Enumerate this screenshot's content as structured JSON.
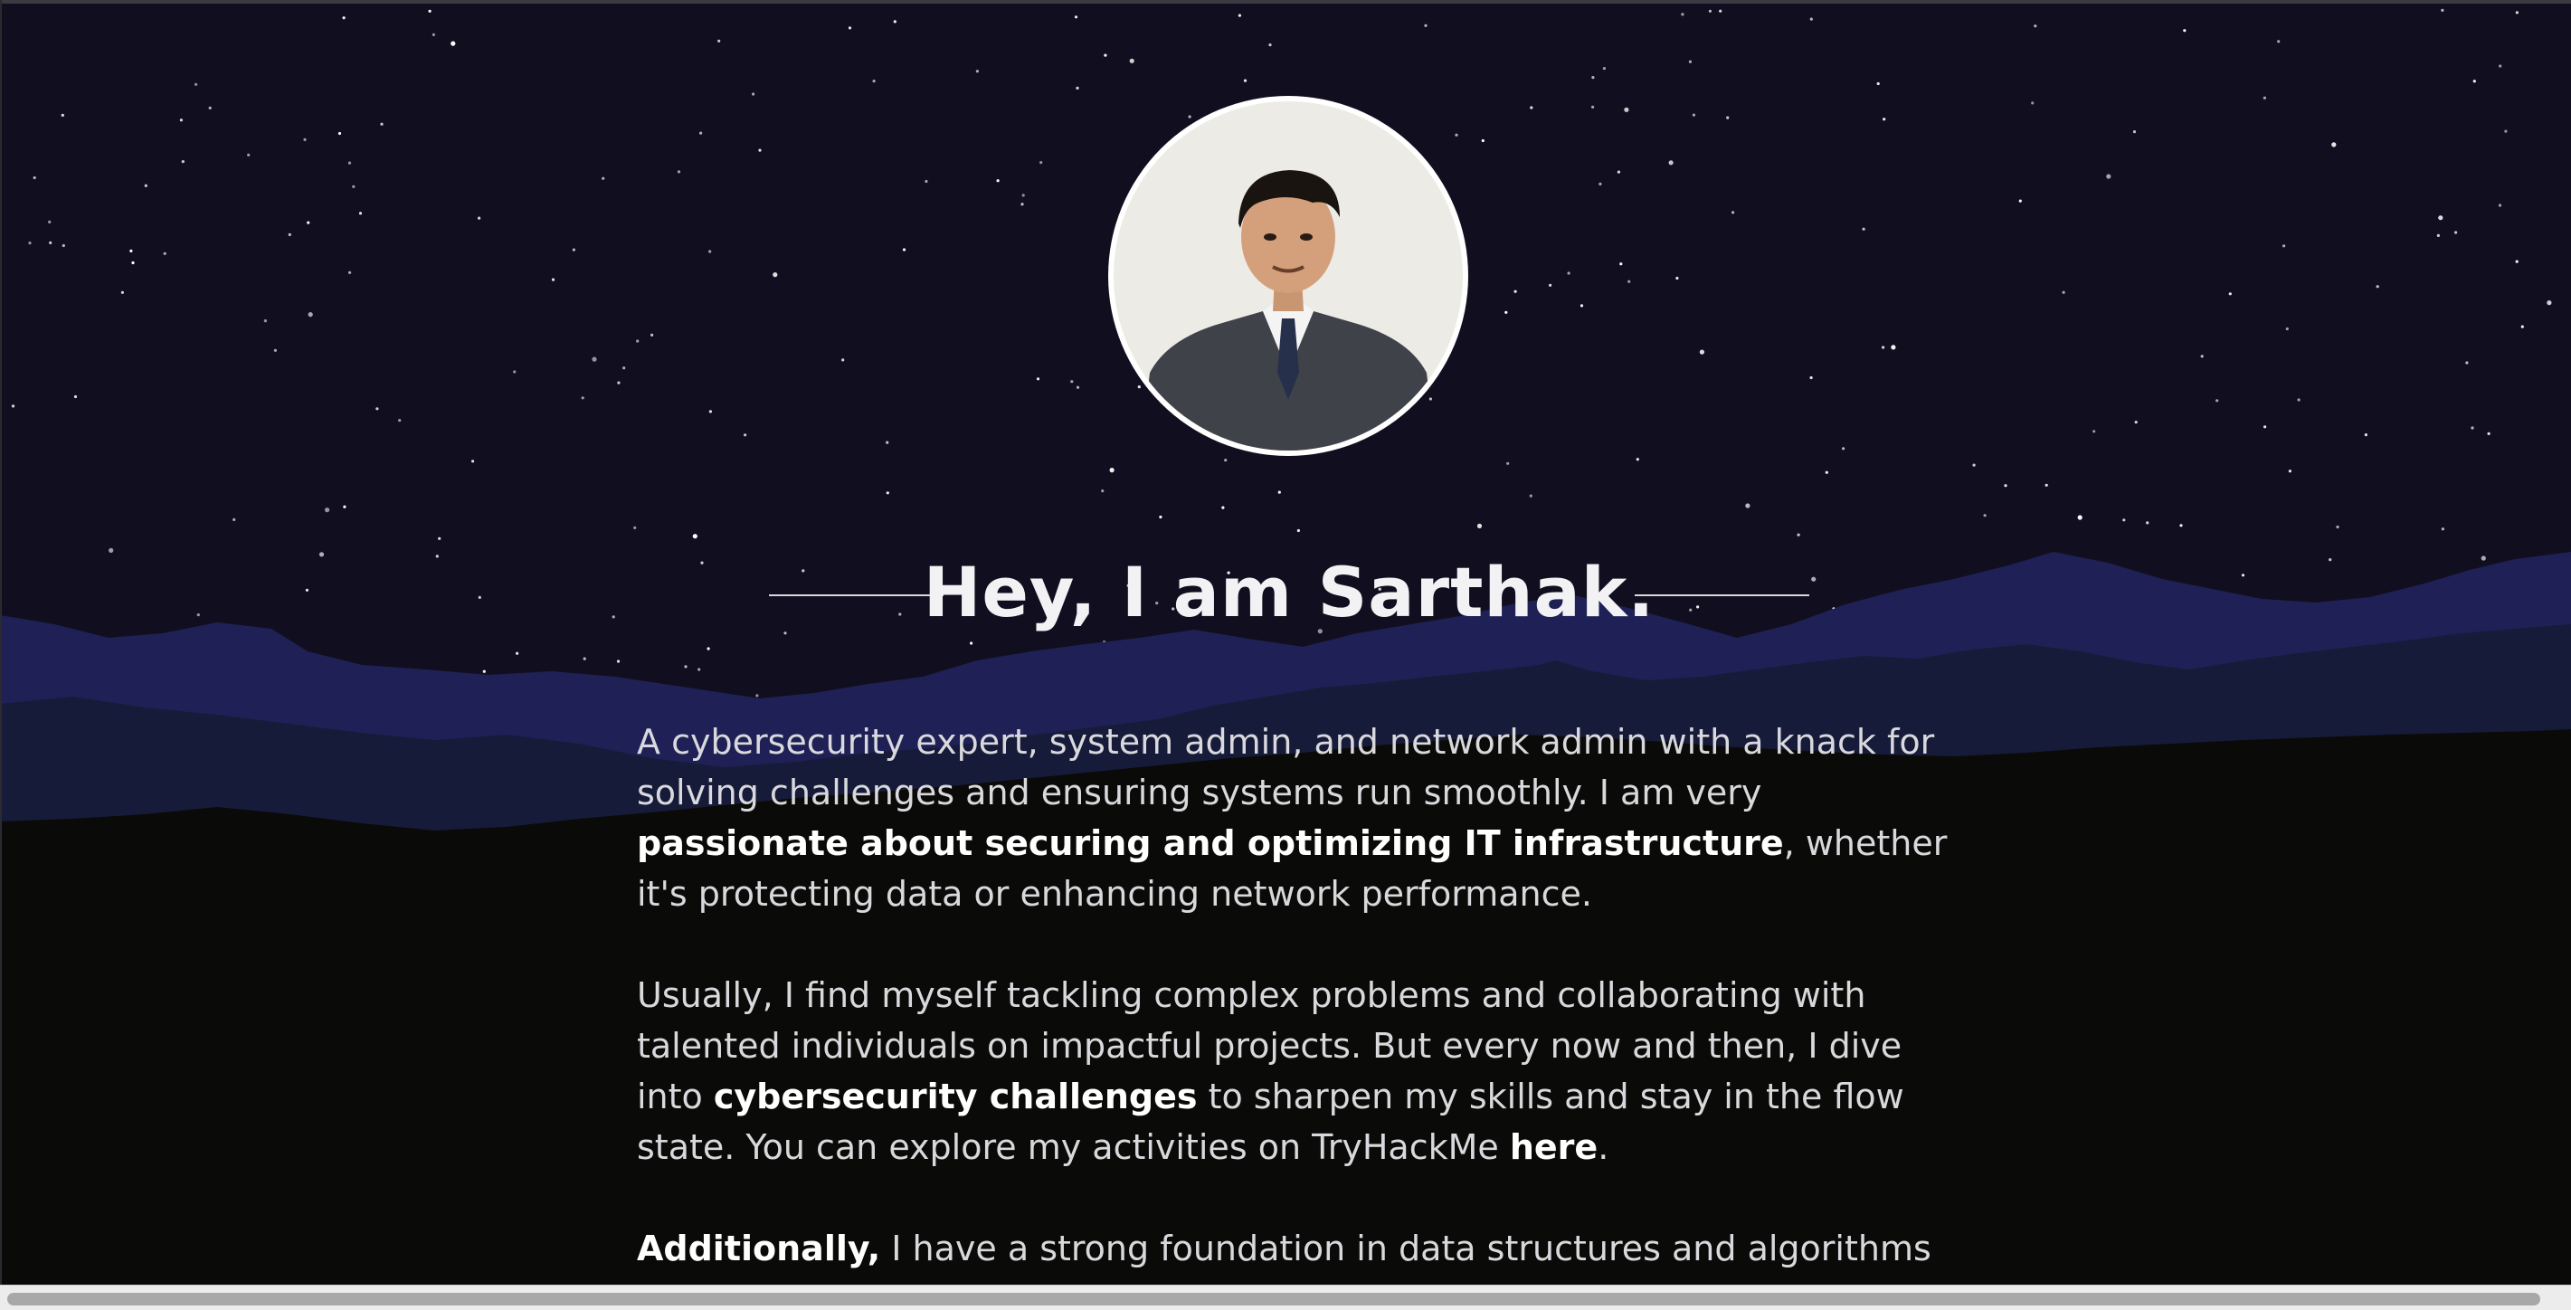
{
  "profile": {
    "avatar_alt": "Portrait of Sarthak"
  },
  "hero": {
    "title": "Hey, I am Sarthak."
  },
  "about": {
    "p1": {
      "t1": "A cybersecurity expert, system admin, and network admin with a knack for solving challenges and ensuring systems run smoothly. I am very ",
      "b1": "passionate about securing and optimizing IT infrastructure",
      "t2": ", whether it's protecting data or enhancing network performance."
    },
    "p2": {
      "t1": "Usually, I find myself tackling complex problems and collaborating with talented individuals on impactful projects. But every now and then, I dive into ",
      "b1": "cybersecurity challenges",
      "t2": " to sharpen my skills and stay in the flow state. You can explore my activities on TryHackMe ",
      "link": "here",
      "t3": "."
    },
    "p3": {
      "b1": "Additionally,",
      "t1": " I have a strong foundation in data structures and algorithms"
    }
  },
  "colors": {
    "sky": "#110f1f",
    "mountain_far": "#1f2156",
    "mountain_mid": "#171b3a",
    "ground": "#0a0b08",
    "text": "#d9d9dd",
    "title": "#f2f2f5"
  },
  "scrollbar": {
    "horizontal": true
  }
}
